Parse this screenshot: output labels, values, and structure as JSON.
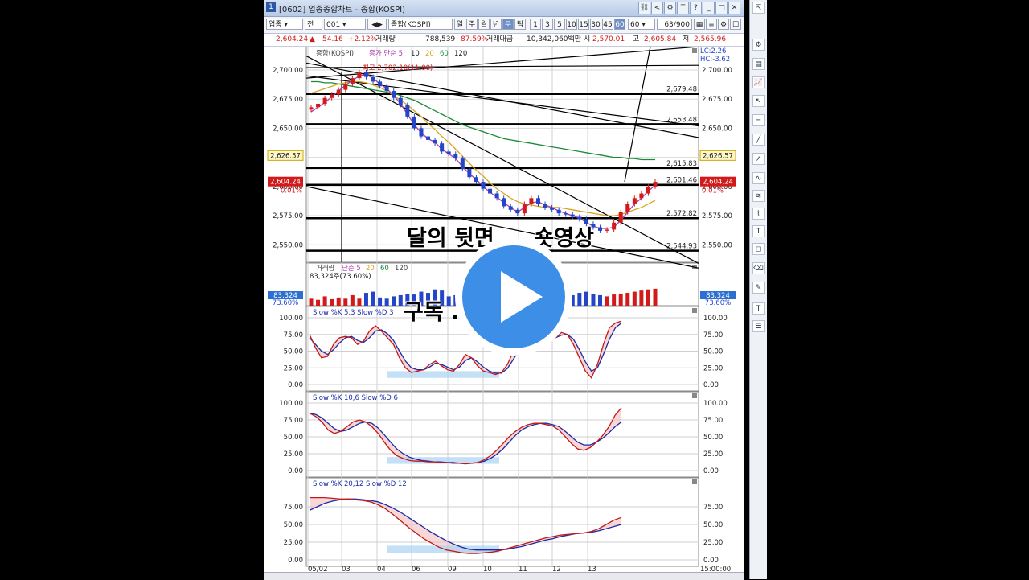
{
  "window": {
    "title": "[0602] 업종종합차트 - 종합(KOSPI)",
    "number": "1",
    "title_buttons": [
      "<",
      "?"
    ]
  },
  "toolbar": {
    "type_select": "업종",
    "code_select": "전",
    "code_value": "001",
    "name_select": "종합(KOSPI)",
    "periods": [
      "일",
      "주",
      "월",
      "년",
      "분",
      "틱"
    ],
    "active_period": "분",
    "minutes": [
      "1",
      "3",
      "5",
      "10",
      "15",
      "30",
      "45",
      "60"
    ],
    "active_minute": "60",
    "minute_select": "60",
    "count": "63/900"
  },
  "quote": {
    "price": "2,604.24",
    "change": "54.16",
    "change_pct": "+2.12%",
    "volume_label": "거래량",
    "volume": "788,539",
    "volume_pct": "87.59%",
    "amount_label": "거래대금",
    "amount": "10,342,060백만",
    "open_label": "시",
    "open": "2,570.01",
    "high_label": "고",
    "high": "2,605.84",
    "low_label": "저",
    "low": "2,565.96"
  },
  "chart_data": [
    {
      "type": "candlestick",
      "legend": "종합(KOSPI)",
      "ma_legend": [
        "종가 단순 5",
        "10",
        "20",
        "60",
        "120"
      ],
      "high_marker": "최고 2,702.10(11:00)",
      "y_ticks": [
        "2,700.00",
        "2,675.00",
        "2,650.00",
        "2,625.00",
        "2,600.00",
        "2,575.00",
        "2,550.00"
      ],
      "current_price_tag": "2,604.24",
      "current_pct_tag": "0.01%",
      "crosshair_tag": "2,626.57",
      "lc_label": "LC:2.26",
      "hc_label": "HC:-3.62",
      "horizontal_levels": [
        "2,679.48",
        "2,653.48",
        "2,615.83",
        "2,601.46",
        "2,572.82",
        "2,544.93"
      ],
      "closes": [
        2668,
        2671,
        2676,
        2679,
        2683,
        2688,
        2693,
        2698,
        2694,
        2690,
        2686,
        2682,
        2676,
        2670,
        2660,
        2650,
        2643,
        2640,
        2637,
        2630,
        2628,
        2624,
        2615,
        2608,
        2604,
        2598,
        2594,
        2590,
        2583,
        2580,
        2577,
        2585,
        2590,
        2585,
        2582,
        2580,
        2577,
        2576,
        2574,
        2572,
        2568,
        2565,
        2562,
        2563,
        2569,
        2578,
        2585,
        2590,
        2594,
        2600,
        2604
      ],
      "ma5": [
        2664,
        2668,
        2672,
        2677,
        2682,
        2687,
        2691,
        2695,
        2696,
        2693,
        2688,
        2684,
        2678,
        2671,
        2662,
        2653,
        2646,
        2641,
        2638,
        2632,
        2628,
        2624,
        2617,
        2611,
        2606,
        2600,
        2595,
        2591,
        2586,
        2582,
        2578,
        2582,
        2586,
        2587,
        2584,
        2582,
        2579,
        2577,
        2575,
        2573,
        2569,
        2566,
        2564,
        2564,
        2565,
        2571,
        2578,
        2585,
        2590,
        2596,
        2601
      ],
      "ma20": [
        2680,
        2682,
        2684,
        2686,
        2688,
        2689,
        2690,
        2690,
        2689,
        2687,
        2685,
        2682,
        2678,
        2674,
        2670,
        2665,
        2660,
        2654,
        2649,
        2643,
        2638,
        2632,
        2626,
        2620,
        2614,
        2609,
        2603,
        2598,
        2594,
        2590,
        2587,
        2585,
        2584,
        2583,
        2582,
        2582,
        2582,
        2581,
        2580,
        2579,
        2578,
        2577,
        2576,
        2575,
        2575,
        2576,
        2578,
        2580,
        2582,
        2585,
        2588
      ],
      "ma60": [
        2690,
        2690,
        2689,
        2689,
        2688,
        2687,
        2686,
        2685,
        2684,
        2683,
        2682,
        2681,
        2680,
        2678,
        2676,
        2674,
        2671,
        2668,
        2665,
        2662,
        2659,
        2656,
        2653,
        2651,
        2649,
        2647,
        2645,
        2643,
        2641,
        2640,
        2639,
        2638,
        2637,
        2636,
        2635,
        2634,
        2633,
        2632,
        2631,
        2630,
        2629,
        2628,
        2627,
        2626,
        2625,
        2625,
        2624,
        2624,
        2623,
        2623,
        2623
      ],
      "y_range": [
        2535,
        2720
      ]
    },
    {
      "type": "bar",
      "legend": [
        "거래량",
        "단순 5",
        "20",
        "60",
        "120"
      ],
      "label": "83,324주(73.60%)",
      "tag_value": "83,324",
      "tag_pct": "73.60%",
      "values": [
        30,
        25,
        40,
        28,
        35,
        30,
        45,
        30,
        55,
        60,
        35,
        30,
        40,
        45,
        50,
        48,
        60,
        55,
        70,
        65,
        40,
        45,
        50,
        60,
        80,
        70,
        50,
        45,
        55,
        60,
        95,
        70,
        40,
        35,
        45,
        50,
        40,
        38,
        45,
        55,
        60,
        50,
        45,
        40,
        48,
        52,
        55,
        60,
        65,
        70,
        73
      ]
    },
    {
      "type": "line",
      "legend": "Slow %K 5,3  Slow %D 3",
      "y_ticks": [
        "100.00",
        "75.00",
        "50.00",
        "25.00",
        "0.00"
      ],
      "k": [
        75,
        55,
        40,
        42,
        60,
        70,
        72,
        70,
        60,
        65,
        80,
        88,
        80,
        70,
        60,
        40,
        25,
        18,
        20,
        22,
        30,
        35,
        28,
        22,
        20,
        30,
        45,
        40,
        28,
        20,
        18,
        15,
        18,
        30,
        50,
        60,
        75,
        85,
        80,
        70,
        65,
        70,
        78,
        75,
        60,
        40,
        20,
        10,
        30,
        60,
        85,
        92,
        95
      ],
      "d": [
        70,
        60,
        50,
        45,
        52,
        62,
        70,
        72,
        66,
        63,
        70,
        80,
        82,
        76,
        66,
        50,
        35,
        25,
        22,
        22,
        26,
        32,
        30,
        26,
        22,
        26,
        36,
        40,
        34,
        26,
        20,
        17,
        17,
        24,
        38,
        52,
        66,
        78,
        80,
        75,
        70,
        70,
        74,
        75,
        68,
        52,
        34,
        20,
        25,
        45,
        68,
        85,
        92
      ]
    },
    {
      "type": "line",
      "legend": "Slow %K 10,6  Slow %D 6",
      "y_ticks": [
        "100.00",
        "75.00",
        "50.00",
        "25.00",
        "0.00"
      ],
      "k": [
        85,
        80,
        72,
        60,
        55,
        58,
        65,
        72,
        75,
        72,
        65,
        55,
        42,
        30,
        22,
        18,
        15,
        14,
        14,
        13,
        13,
        12,
        12,
        11,
        11,
        10,
        11,
        12,
        16,
        22,
        30,
        40,
        50,
        58,
        64,
        68,
        70,
        70,
        68,
        66,
        60,
        50,
        40,
        32,
        30,
        34,
        42,
        52,
        65,
        82,
        93
      ],
      "d": [
        85,
        83,
        78,
        70,
        62,
        58,
        60,
        65,
        70,
        72,
        70,
        63,
        53,
        42,
        32,
        25,
        20,
        17,
        15,
        14,
        13,
        13,
        12,
        12,
        11,
        11,
        11,
        12,
        14,
        18,
        24,
        32,
        42,
        52,
        60,
        65,
        68,
        70,
        70,
        68,
        65,
        58,
        50,
        42,
        38,
        38,
        42,
        48,
        56,
        65,
        72
      ]
    },
    {
      "type": "line",
      "legend": "Slow %K 20,12  Slow %D 12",
      "y_ticks": [
        "75.00",
        "50.00",
        "25.00",
        "0.00"
      ],
      "k": [
        88,
        88,
        88,
        87,
        86,
        86,
        85,
        84,
        82,
        78,
        72,
        64,
        55,
        46,
        38,
        30,
        24,
        18,
        14,
        12,
        10,
        9,
        9,
        10,
        11,
        13,
        16,
        19,
        22,
        25,
        28,
        31,
        33,
        35,
        36,
        37,
        38,
        40,
        44,
        50,
        56,
        60
      ],
      "d": [
        70,
        75,
        80,
        83,
        85,
        86,
        86,
        85,
        84,
        82,
        78,
        73,
        67,
        60,
        53,
        46,
        39,
        33,
        27,
        22,
        18,
        15,
        14,
        14,
        14,
        14,
        15,
        17,
        19,
        22,
        25,
        28,
        30,
        33,
        35,
        37,
        38,
        39,
        41,
        44,
        47,
        50
      ]
    }
  ],
  "x_axis": [
    "05/02",
    "03",
    "04",
    "06",
    "09",
    "10",
    "11",
    "12",
    "13",
    "15:00:00"
  ],
  "overlay": {
    "line1": "달의 뒷면 ... 숏영상",
    "line2": "구독 ... 좌♡"
  }
}
